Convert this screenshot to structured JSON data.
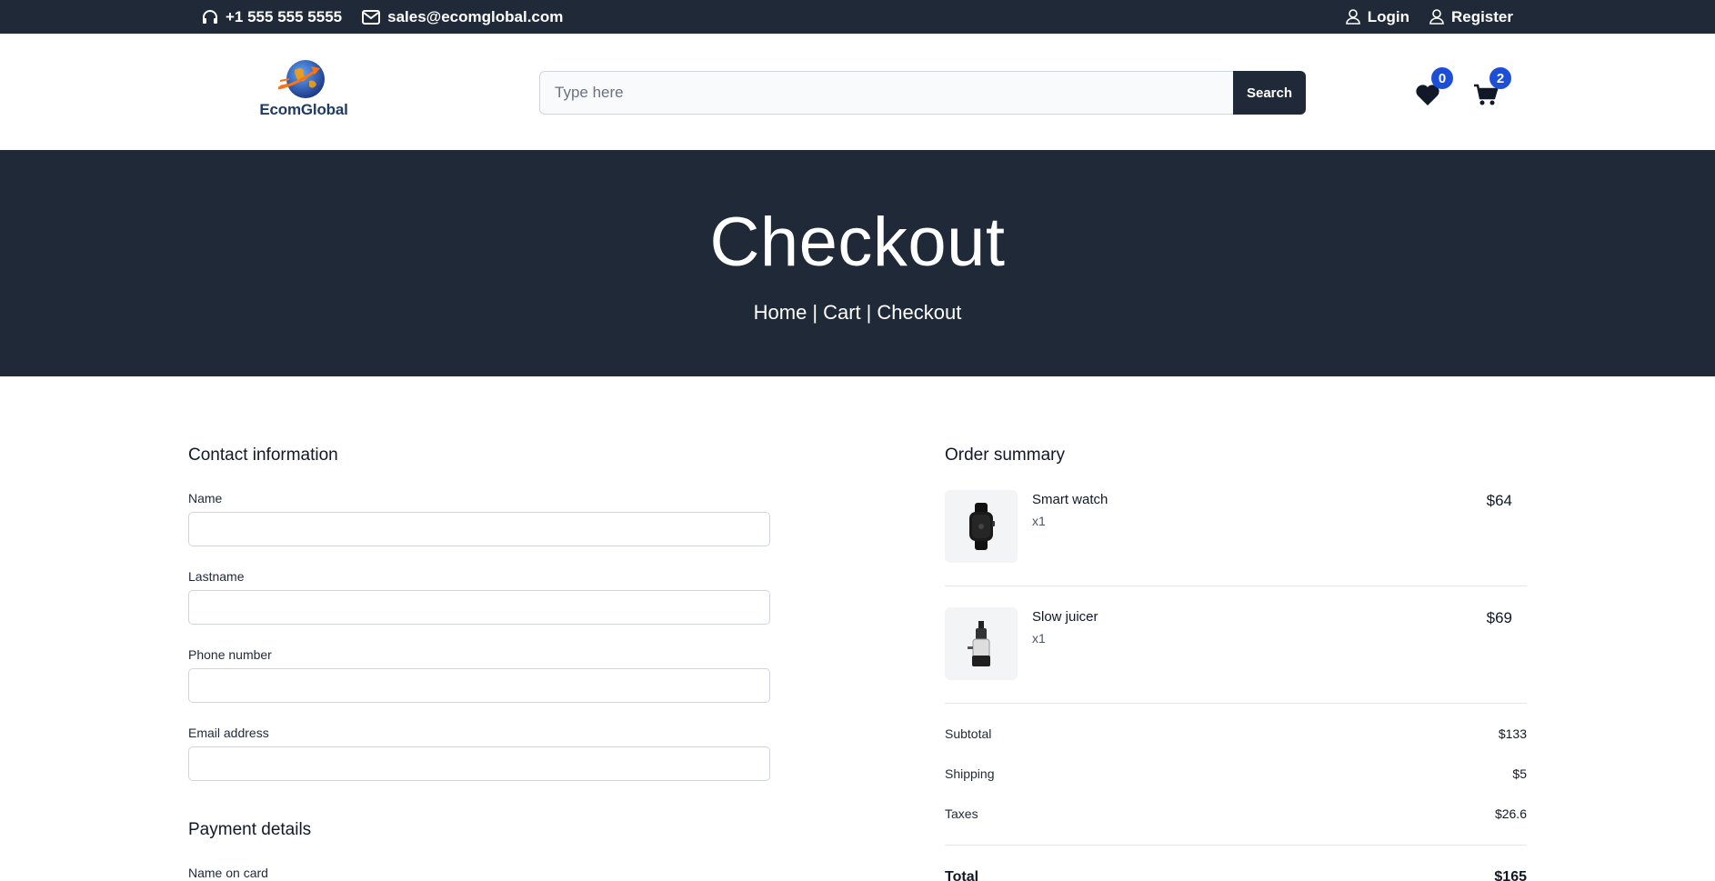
{
  "topbar": {
    "phone": "+1 555 555 5555",
    "email": "sales@ecomglobal.com",
    "login": "Login",
    "register": "Register"
  },
  "header": {
    "logo_text": "EcomGlobal",
    "search_placeholder": "Type here",
    "search_button": "Search",
    "wishlist_count": "0",
    "cart_count": "2"
  },
  "hero": {
    "title": "Checkout",
    "breadcrumb": [
      "Home",
      "Cart",
      "Checkout"
    ],
    "separator": "|"
  },
  "contact": {
    "title": "Contact information",
    "fields": [
      "Name",
      "Lastname",
      "Phone number",
      "Email address"
    ]
  },
  "payment": {
    "title": "Payment details",
    "name_on_card_label": "Name on card"
  },
  "summary": {
    "title": "Order summary",
    "items": [
      {
        "name": "Smart watch",
        "qty": "x1",
        "price": "$64"
      },
      {
        "name": "Slow juicer",
        "qty": "x1",
        "price": "$69"
      }
    ],
    "subtotal_label": "Subtotal",
    "subtotal": "$133",
    "shipping_label": "Shipping",
    "shipping": "$5",
    "taxes_label": "Taxes",
    "taxes": "$26.6",
    "total_label": "Total",
    "total": "$165"
  },
  "colors": {
    "dark": "#1f2937",
    "badge": "#1d4ed8",
    "logo_blue": "#1f3b63",
    "logo_orange": "#f97316"
  }
}
